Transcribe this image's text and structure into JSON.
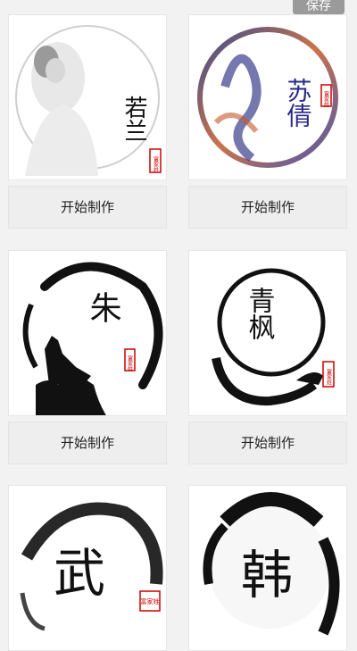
{
  "header": {
    "save_label": "保存"
  },
  "cards": [
    {
      "name_text": "若兰",
      "seal_text": "富家姓",
      "button_label": "开始制作"
    },
    {
      "name_text": "苏倩",
      "seal_text": "富家姓",
      "button_label": "开始制作"
    },
    {
      "name_text": "朱",
      "seal_text": "富家姓",
      "button_label": "开始制作"
    },
    {
      "name_text": "青枫",
      "seal_text": "富家姓",
      "button_label": "开始制作"
    },
    {
      "name_text": "武",
      "seal_text": "富家姓"
    },
    {
      "name_text": "韩"
    }
  ]
}
